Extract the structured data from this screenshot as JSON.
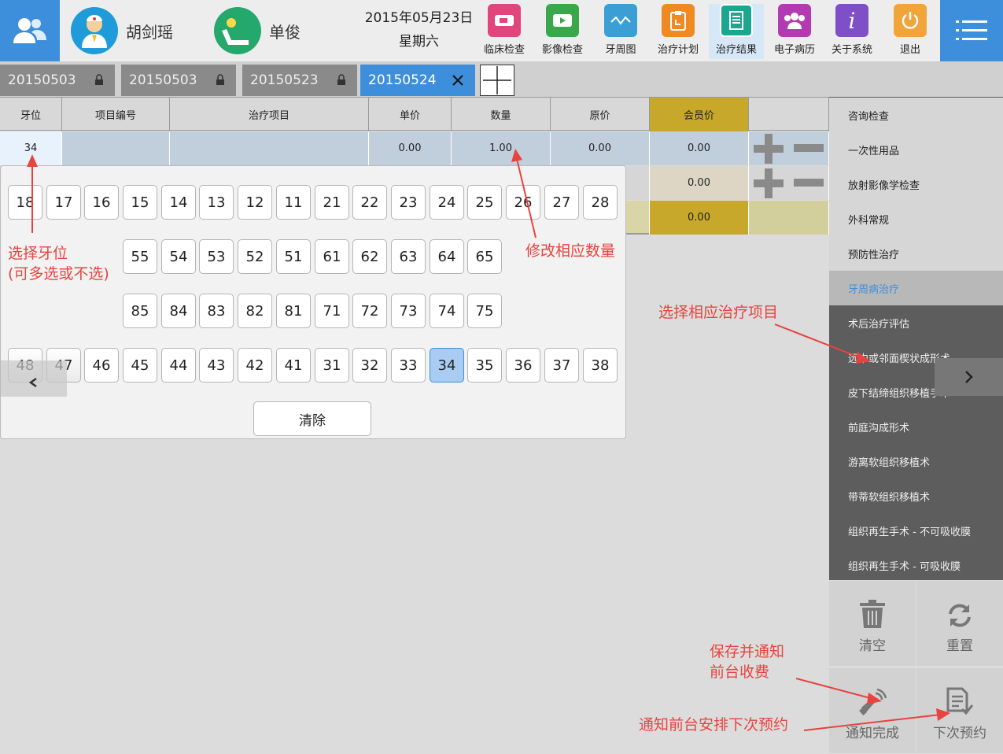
{
  "header": {
    "doctor_name": "胡剑瑶",
    "patient_name": "单俊",
    "date": "2015年05月23日",
    "weekday": "星期六",
    "toolbar": [
      {
        "label": "临床检查",
        "icon": "ticket-icon",
        "color": "#e0457b"
      },
      {
        "label": "影像检查",
        "icon": "video-play-icon",
        "color": "#3aa84a"
      },
      {
        "label": "牙周图",
        "icon": "line-chart-icon",
        "color": "#3b9fd6"
      },
      {
        "label": "治疗计划",
        "icon": "clipboard-icon",
        "color": "#ef8a22"
      },
      {
        "label": "治疗结果",
        "icon": "receipt-icon",
        "color": "#1aa68f"
      },
      {
        "label": "电子病历",
        "icon": "group-icon",
        "color": "#b33ab0"
      },
      {
        "label": "关于系统",
        "icon": "info-icon",
        "color": "#7e4fc6"
      },
      {
        "label": "退出",
        "icon": "power-icon",
        "color": "#f0a43a"
      }
    ]
  },
  "tabs": [
    {
      "label": "20150503",
      "locked": true
    },
    {
      "label": "20150503",
      "locked": true
    },
    {
      "label": "20150523",
      "locked": true
    },
    {
      "label": "20150524",
      "locked": false
    }
  ],
  "table": {
    "headers": [
      "牙位",
      "项目编号",
      "治疗项目",
      "单价",
      "数量",
      "原价",
      "会员价",
      ""
    ],
    "row1": {
      "tooth": "34",
      "code": "",
      "item": "",
      "unit_price": "0.00",
      "qty": "1.00",
      "orig_price": "0.00",
      "member_price": "0.00"
    },
    "row2": {
      "member_price": "0.00"
    },
    "total_row": {
      "member_price": "0.00"
    }
  },
  "teeth": {
    "row1": [
      "18",
      "17",
      "16",
      "15",
      "14",
      "13",
      "12",
      "11",
      "21",
      "22",
      "23",
      "24",
      "25",
      "26",
      "27",
      "28"
    ],
    "row2": [
      "55",
      "54",
      "53",
      "52",
      "51",
      "61",
      "62",
      "63",
      "64",
      "65"
    ],
    "row3": [
      "85",
      "84",
      "83",
      "82",
      "81",
      "71",
      "72",
      "73",
      "74",
      "75"
    ],
    "row4": [
      "48",
      "47",
      "46",
      "45",
      "44",
      "43",
      "42",
      "41",
      "31",
      "32",
      "33",
      "34",
      "35",
      "36",
      "37",
      "38"
    ],
    "selected": "34",
    "clear_label": "清除"
  },
  "side_menu": {
    "items": [
      "咨询检查",
      "一次性用品",
      "放射影像学检查",
      "外科常规",
      "预防性治疗",
      "牙周病治疗",
      "术后治疗评估",
      "远中或邻面楔状成形术",
      "皮下结缔组织移植手术",
      "前庭沟成形术",
      "游离软组织移植术",
      "带蒂软组织移植术",
      "组织再生手术 - 不可吸收膜",
      "组织再生手术 - 可吸收膜"
    ],
    "selected": "牙周病治疗"
  },
  "actions": {
    "clear": "清空",
    "reset": "重置",
    "notify_done": "通知完成",
    "next_appointment": "下次预约"
  },
  "annotations": {
    "select_tooth_1": "选择牙位",
    "select_tooth_2": "(可多选或不选)",
    "modify_qty": "修改相应数量",
    "select_item": "选择相应治疗项目",
    "save_notify_1": "保存并通知",
    "save_notify_2": "前台收费",
    "notify_next": "通知前台安排下次预约"
  },
  "colors": {
    "accent": "#3d8fdb",
    "member_price_bg": "#c8a82a",
    "annotation": "#e8433f"
  }
}
